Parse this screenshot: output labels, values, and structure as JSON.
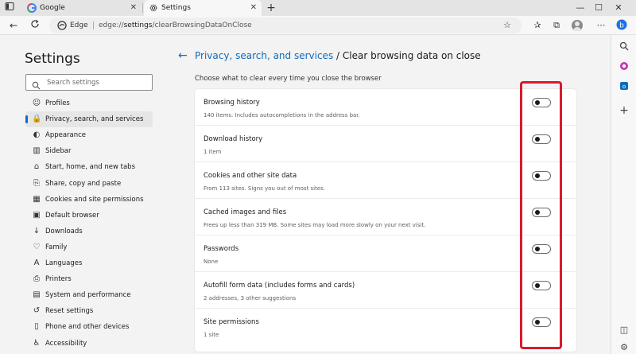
{
  "browser": {
    "tabs": [
      {
        "label": "Google",
        "icon": "google-icon",
        "active": false
      },
      {
        "label": "Settings",
        "icon": "gear-icon",
        "active": true
      }
    ],
    "new_tab_label": "+",
    "address": {
      "site_name": "Edge",
      "url_prefix": "edge://",
      "url_bold": "settings",
      "url_suffix": "/clearBrowsingDataOnClose"
    }
  },
  "settings_nav": {
    "title": "Settings",
    "search_placeholder": "Search settings",
    "items": [
      {
        "label": "Profiles",
        "icon": "profile-icon"
      },
      {
        "label": "Privacy, search, and services",
        "icon": "lock-icon",
        "active": true
      },
      {
        "label": "Appearance",
        "icon": "appearance-icon"
      },
      {
        "label": "Sidebar",
        "icon": "sidebar-icon"
      },
      {
        "label": "Start, home, and new tabs",
        "icon": "home-icon"
      },
      {
        "label": "Share, copy and paste",
        "icon": "share-icon"
      },
      {
        "label": "Cookies and site permissions",
        "icon": "cookies-icon"
      },
      {
        "label": "Default browser",
        "icon": "browser-icon"
      },
      {
        "label": "Downloads",
        "icon": "download-icon"
      },
      {
        "label": "Family",
        "icon": "family-icon"
      },
      {
        "label": "Languages",
        "icon": "languages-icon"
      },
      {
        "label": "Printers",
        "icon": "printer-icon"
      },
      {
        "label": "System and performance",
        "icon": "system-icon"
      },
      {
        "label": "Reset settings",
        "icon": "reset-icon"
      },
      {
        "label": "Phone and other devices",
        "icon": "phone-icon"
      },
      {
        "label": "Accessibility",
        "icon": "accessibility-icon"
      }
    ]
  },
  "main": {
    "breadcrumb_parent": "Privacy, search, and services",
    "breadcrumb_sep": " / ",
    "page_title": "Clear browsing data on close",
    "subtitle": "Choose what to clear every time you close the browser",
    "rows": [
      {
        "title": "Browsing history",
        "desc": "140 items. Includes autocompletions in the address bar.",
        "enabled": false
      },
      {
        "title": "Download history",
        "desc": "1 item",
        "enabled": false
      },
      {
        "title": "Cookies and other site data",
        "desc": "From 113 sites. Signs you out of most sites.",
        "enabled": false
      },
      {
        "title": "Cached images and files",
        "desc": "Frees up less than 319 MB. Some sites may load more slowly on your next visit.",
        "enabled": false
      },
      {
        "title": "Passwords",
        "desc": "None",
        "enabled": false
      },
      {
        "title": "Autofill form data (includes forms and cards)",
        "desc": "2 addresses, 3 other suggestions",
        "enabled": false
      },
      {
        "title": "Site permissions",
        "desc": "1 site",
        "enabled": false
      }
    ]
  },
  "colors": {
    "accent": "#0f6cbd",
    "highlight": "#d91b2a"
  }
}
